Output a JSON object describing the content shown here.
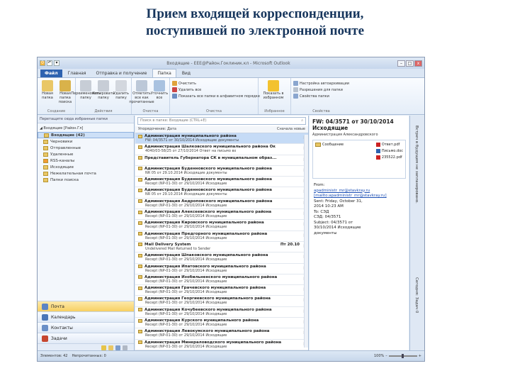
{
  "slide": {
    "title_line1": "Прием входящей корреспонденции,",
    "title_line2": "поступившей по электронной почте"
  },
  "window": {
    "title": "Входящие - ЕЕЕ@Район.Гоклиник.кл - Microsoft Outlook",
    "qat": [
      "0",
      "↶",
      "▾"
    ],
    "controls": [
      "–",
      "□",
      "x"
    ]
  },
  "tabs": [
    "Файл",
    "Главная",
    "Отправка и получение",
    "Папка",
    "Вид"
  ],
  "ribbon": {
    "groups": [
      {
        "label": "Создание",
        "big": [
          "Новая папка",
          "Новая папка поиска"
        ]
      },
      {
        "label": "Действия",
        "big": [
          "Переименовать папку",
          "Копировать папку",
          "Удалить папку"
        ]
      },
      {
        "label": "Очистка",
        "big": [
          "Отметить все как прочитанные",
          "Уточнить все"
        ]
      },
      {
        "label": "Очистка",
        "small": [
          "Очистить",
          "Удалить все",
          "Показать все папки в алфавитном порядке"
        ]
      },
      {
        "label": "Избранное",
        "big": [
          "Показать в избранном"
        ]
      },
      {
        "label": "Свойства",
        "small": [
          "Настройка автоархивации",
          "Разрешения для папки",
          "Свойства папки"
        ]
      }
    ]
  },
  "nav": {
    "header": "Перетащите сюда избранные папки",
    "root": "◢ Входящие [Район.Гл]",
    "folders": [
      {
        "name": "Входящие (42)",
        "selected": true
      },
      {
        "name": "Черновики",
        "selected": false
      },
      {
        "name": "Отправленные",
        "selected": false
      },
      {
        "name": "Удаленные",
        "selected": false
      },
      {
        "name": "RSS-каналы",
        "selected": false
      },
      {
        "name": "Исходящие",
        "selected": false
      },
      {
        "name": "Нежелательная почта",
        "selected": false
      },
      {
        "name": "Папки поиска",
        "selected": false
      }
    ],
    "buttons": [
      {
        "label": "Почта",
        "selected": true
      },
      {
        "label": "Календарь",
        "selected": false
      },
      {
        "label": "Контакты",
        "selected": false
      },
      {
        "label": "Задачи",
        "selected": false
      }
    ]
  },
  "mlist": {
    "search_placeholder": "Поиск в папке: Входящие (CTRL+E)",
    "arrange_left": "Упорядочение: Дата",
    "arrange_right": "Сначала новые",
    "messages": [
      {
        "from": "Администрация муниципального района",
        "subject": "FW: 04/3571 от 30/10/2014 Исходящие документы",
        "date": "",
        "selected": true
      },
      {
        "from": "Администрация Шалковского муниципального района Ок",
        "subject": "4040/03-58/25 от 27/10/2014 Ответ на письмо вх",
        "date": "",
        "selected": false
      },
      {
        "from": "Представитель Губернатора СК в муниципальном образ...",
        "subject": "",
        "date": "",
        "selected": false
      },
      {
        "from": "Администрация Буденновского муниципального района",
        "subject": "NR 05 от 29.10.2014 Исходящие документы",
        "date": "",
        "selected": false
      },
      {
        "from": "Администрация Буденновского муниципального района",
        "subject": "Recept (NP-01-30) от 29/10/2014 Исходящие",
        "date": "",
        "selected": false
      },
      {
        "from": "Администрация Буденновского муниципального района",
        "subject": "NR 05 от 29.10.2014 Исходящие документы",
        "date": "",
        "selected": false
      },
      {
        "from": "Администрация Андроповского муниципального района",
        "subject": "Recept (NP-01-30) от 29/10/2014 Исходящие",
        "date": "",
        "selected": false
      },
      {
        "from": "Администрация Алексеевского муниципального района",
        "subject": "Recept (NP-01-30) от 29/10/2014 Исходящие",
        "date": "",
        "selected": false
      },
      {
        "from": "Администрация Кировского муниципального района",
        "subject": "Recept (NP-01-30) от 29/10/2014 Исходящие",
        "date": "",
        "selected": false
      },
      {
        "from": "Администрация Предгорного муниципального района",
        "subject": "Recept (NP-01-30) от 29/10/2014 Исходящие",
        "date": "",
        "selected": false
      },
      {
        "from": "Mail Delivery System",
        "subject": "Undelivered Mail Returned to Sender",
        "date": "Пт 20.10",
        "selected": false
      },
      {
        "from": "Администрация Шпаковского муниципального района",
        "subject": "Recept (NP-01-30) от 29/10/2014 Исходящие",
        "date": "",
        "selected": false
      },
      {
        "from": "Администрация Ипатовского муниципального района",
        "subject": "Recept (NP-01-30) от 29/10/2014 Исходящие",
        "date": "",
        "selected": false
      },
      {
        "from": "Администрация Изобильненского муниципального района",
        "subject": "Recept (NP-01-30) от 29/10/2014 Исходящие",
        "date": "",
        "selected": false
      },
      {
        "from": "Администрация Грачевского муниципального района",
        "subject": "Recept (NP-01-30) от 29/10/2014 Исходящие",
        "date": "",
        "selected": false
      },
      {
        "from": "Администрация Георгиевского муниципального района",
        "subject": "Recept (NP-01-30) от 29/10/2014 Исходящие",
        "date": "",
        "selected": false
      },
      {
        "from": "Администрация Кочубеевского муниципального района",
        "subject": "Recept (NP-01-30) от 29/10/2014 Исходящие",
        "date": "",
        "selected": false
      },
      {
        "from": "Администрация Курского муниципального района",
        "subject": "Recept (NP-01-30) от 29/10/2014 Исходящие",
        "date": "",
        "selected": false
      },
      {
        "from": "Администрация Левокумского муниципального района",
        "subject": "Recept (NP-01-30) от 29/10/2014 Исходящие",
        "date": "",
        "selected": false
      },
      {
        "from": "Администрация Минераловодского муниципального района",
        "subject": "Recept (NP-01-30) от 29/10/2014 Исходящие",
        "date": "",
        "selected": false
      }
    ]
  },
  "reading": {
    "subject": "FW: 04/3571 от 30/10/2014 Исходящие",
    "from": "Администрация Александровского",
    "attach_folder": "Сообщение",
    "attachments": [
      "Ответ.pdf",
      "Письмо.doc",
      "235522.pdf"
    ],
    "body": [
      {
        "t": "From:",
        "link": false
      },
      {
        "t": "apadministr_mr@stavkray.ru",
        "link": true
      },
      {
        "t": "[mailto:apadministr_mr@stavkray.ru]",
        "link": true
      },
      {
        "t": "Sent: Friday, October 31,",
        "link": false
      },
      {
        "t": "2014 10:23 AM",
        "link": false
      },
      {
        "t": "To: СЭД",
        "link": false
      },
      {
        "t": "СЭД: 04/3571",
        "link": false
      },
      {
        "t": "Subject: 04/3571 от",
        "link": false
      },
      {
        "t": "30/10/2014 Исходящие",
        "link": false
      },
      {
        "t": "документы",
        "link": false
      }
    ]
  },
  "todo": {
    "label1": "Встреч в будущем не запланировано.",
    "label2": "Сегодня: Задач 0"
  },
  "status": {
    "left": "Элементов: 42",
    "mid": "Непрочитанных: 0",
    "zoom": "100%"
  },
  "colors": {
    "accent": "#2d62b0",
    "title_color": "#17365d"
  }
}
